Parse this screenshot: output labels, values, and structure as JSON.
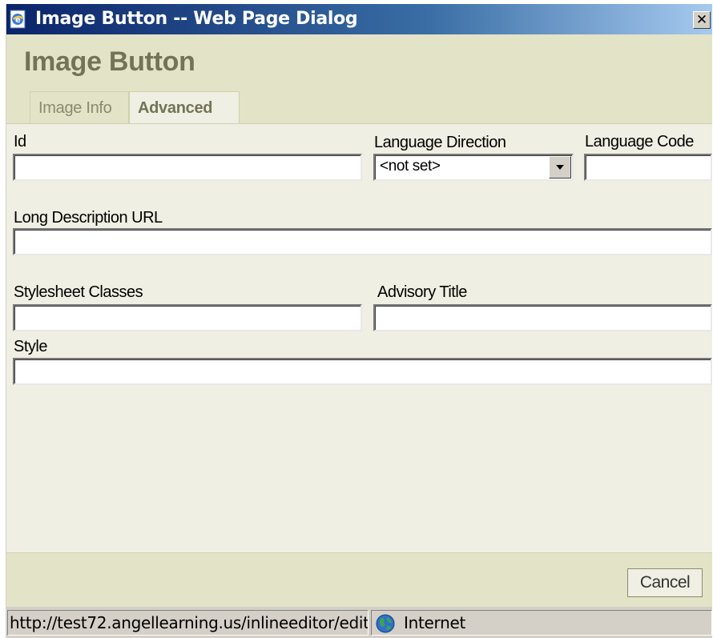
{
  "window": {
    "title": "Image Button -- Web Page Dialog",
    "close_glyph": "✕"
  },
  "dialog": {
    "heading": "Image Button",
    "tabs": [
      {
        "label": "Image Info",
        "active": false
      },
      {
        "label": "Advanced",
        "active": true
      }
    ]
  },
  "form": {
    "id_label": "Id",
    "id_value": "",
    "lang_dir_label": "Language Direction",
    "lang_dir_selected": "<not set>",
    "lang_code_label": "Language Code",
    "lang_code_value": "",
    "long_desc_label": "Long Description URL",
    "long_desc_value": "",
    "css_label": "Stylesheet Classes",
    "css_value": "",
    "advisory_label": "Advisory Title",
    "advisory_value": "",
    "style_label": "Style",
    "style_value": ""
  },
  "footer": {
    "cancel_label": "Cancel"
  },
  "statusbar": {
    "url": "http://test72.angellearning.us/inlineeditor/edit",
    "zone": "Internet"
  },
  "colors": {
    "titlebar": "#0a246a",
    "dialog_bg": "#efefe3",
    "heading": "#737357"
  }
}
